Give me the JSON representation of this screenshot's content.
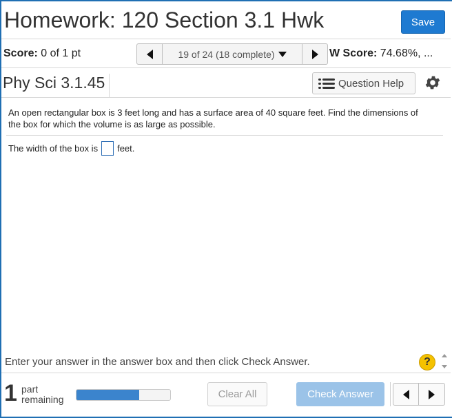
{
  "header": {
    "title": "Homework: 120 Section 3.1 Hwk",
    "save_label": "Save"
  },
  "score_bar": {
    "score_label": "Score:",
    "score_value": "0 of 1 pt",
    "question_nav": "19 of 24 (18 complete)",
    "hw_score_label": "W Score:",
    "hw_score_value": "74.68%, ..."
  },
  "question": {
    "id": "Phy Sci 3.1.45",
    "help_label": "Question Help",
    "text": "An open rectangular box is 3 feet long and has a surface area of 40 square feet.  Find the dimensions of the box for which the volume is as large as possible.",
    "answer_prefix": "The width of the box is",
    "answer_value": "",
    "answer_suffix": "feet."
  },
  "instruction": "Enter your answer in the answer box and then click Check Answer.",
  "footer": {
    "parts_count": "1",
    "parts_label_line1": "part",
    "parts_label_line2": "remaining",
    "progress_fraction": 0.67,
    "clear_label": "Clear All",
    "check_label": "Check Answer"
  },
  "colors": {
    "accent": "#1e7ad1",
    "progress_fill": "#3b84cd",
    "check_disabled": "#9bc3e8",
    "help_icon": "#f5c200"
  },
  "icons": {
    "prev": "triangle-left-icon",
    "next": "triangle-right-icon",
    "dropdown": "triangle-down-icon",
    "list": "list-icon",
    "settings": "gear-icon",
    "help": "question-mark-icon"
  }
}
